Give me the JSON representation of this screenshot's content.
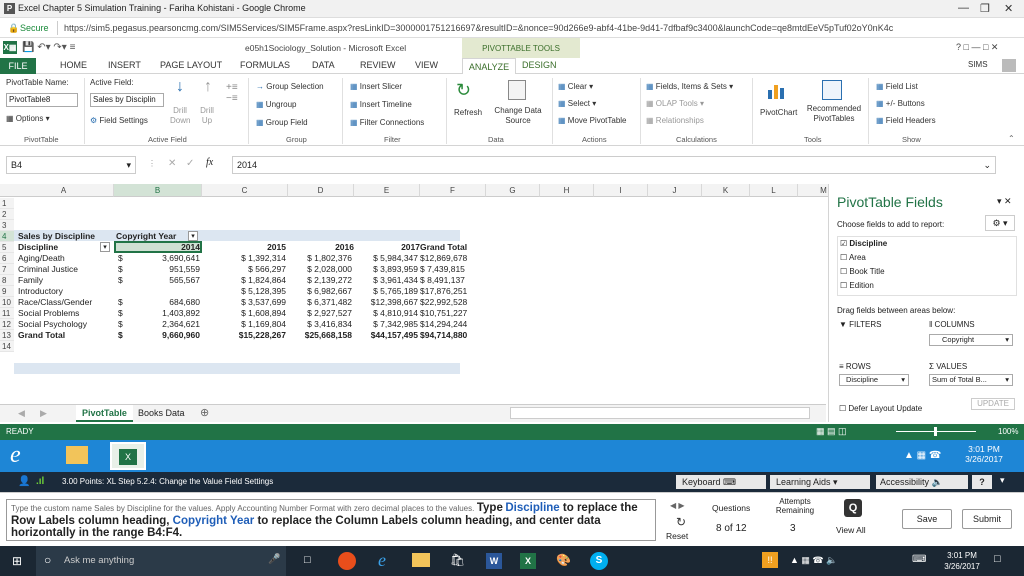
{
  "chrome": {
    "window_title": "Excel Chapter 5 Simulation Training - Fariha Kohistani - Google Chrome",
    "secure_label": "Secure",
    "url": "https://sim5.pegasus.pearsoncmg.com/SIM5Services/SIM5Frame.aspx?resLinkID=3000001751216697&resultID=&nonce=90d266e9-abf4-41be-9d41-7dfbaf9c3400&launchCode=qe8mtdEeV5pTuf02oY0nK4c"
  },
  "excel": {
    "doc_title": "e05h1Sociology_Solution - Microsoft Excel",
    "context_tools": "PIVOTTABLE TOOLS",
    "user": "SIMS",
    "tabs": [
      "FILE",
      "HOME",
      "INSERT",
      "PAGE LAYOUT",
      "FORMULAS",
      "DATA",
      "REVIEW",
      "VIEW",
      "ANALYZE",
      "DESIGN"
    ]
  },
  "ribbon": {
    "pt_name_label": "PivotTable Name:",
    "pt_name_value": "PivotTable8",
    "options": "Options",
    "active_field_label": "Active Field:",
    "active_field_value": "Sales by Disciplin",
    "field_settings": "Field Settings",
    "drill_down": "Drill Down",
    "drill_up": "Drill Up",
    "group_selection": "Group Selection",
    "ungroup": "Ungroup",
    "group_field": "Group Field",
    "insert_slicer": "Insert Slicer",
    "insert_timeline": "Insert Timeline",
    "filter_connections": "Filter Connections",
    "refresh": "Refresh",
    "change_data_source": "Change Data Source",
    "clear": "Clear",
    "select": "Select",
    "move_pivottable": "Move PivotTable",
    "fields_items_sets": "Fields, Items & Sets",
    "olap_tools": "OLAP Tools",
    "relationships": "Relationships",
    "pivotchart": "PivotChart",
    "recommended_pivottables": "Recommended PivotTables",
    "field_list": "Field List",
    "buttons": "+/- Buttons",
    "field_headers": "Field Headers",
    "groups": [
      "PivotTable",
      "Active Field",
      "Group",
      "Filter",
      "Data",
      "Actions",
      "Calculations",
      "Tools",
      "Show"
    ]
  },
  "formula": {
    "namebox": "B4",
    "value": "2014"
  },
  "grid": {
    "columns": [
      "A",
      "B",
      "C",
      "D",
      "E",
      "F",
      "G",
      "H",
      "I",
      "J",
      "K",
      "L",
      "M"
    ],
    "rows": [
      "1",
      "2",
      "3",
      "4",
      "5",
      "6",
      "7",
      "8",
      "9",
      "10",
      "11",
      "12",
      "13",
      "14"
    ],
    "a3": "Sales by Discipline",
    "b3": "Copyright Year",
    "header": [
      "Discipline",
      "2014",
      "2015",
      "2016",
      "2017",
      "Grand Total"
    ],
    "data": [
      [
        "Aging/Death",
        "$",
        "3,690,641",
        "$ 1,392,314",
        "$ 1,802,376",
        "$ 5,984,347",
        "$12,869,678"
      ],
      [
        "Criminal Justice",
        "$",
        "951,559",
        "$ 566,297",
        "$ 2,028,000",
        "$ 3,893,959",
        "$ 7,439,815"
      ],
      [
        "Family",
        "$",
        "565,567",
        "$ 1,824,864",
        "$ 2,139,272",
        "$ 3,961,434",
        "$ 8,491,137"
      ],
      [
        "Introductory",
        "",
        "",
        "$ 5,128,395",
        "$ 6,982,667",
        "$ 5,765,189",
        "$17,876,251"
      ],
      [
        "Race/Class/Gender",
        "$",
        "684,680",
        "$ 3,537,699",
        "$ 6,371,482",
        "$12,398,667",
        "$22,992,528"
      ],
      [
        "Social Problems",
        "$",
        "1,403,892",
        "$ 1,608,894",
        "$ 2,927,527",
        "$ 4,810,914",
        "$10,751,227"
      ],
      [
        "Social Psychology",
        "$",
        "2,364,621",
        "$ 1,169,804",
        "$ 3,416,834",
        "$ 7,342,985",
        "$14,294,244"
      ],
      [
        "Grand Total",
        "$",
        "9,660,960",
        "$15,228,267",
        "$25,668,158",
        "$44,157,495",
        "$94,714,880"
      ]
    ]
  },
  "sheets": [
    "PivotTable",
    "Books Data"
  ],
  "status": {
    "ready": "READY",
    "zoom": "100%"
  },
  "pane": {
    "title": "PivotTable Fields",
    "choose": "Choose fields to add to report:",
    "fields": [
      {
        "name": "Discipline",
        "checked": true
      },
      {
        "name": "Area",
        "checked": false
      },
      {
        "name": "Book Title",
        "checked": false
      },
      {
        "name": "Edition",
        "checked": false
      }
    ],
    "drag": "Drag fields between areas below:",
    "filters": "FILTERS",
    "columns": "COLUMNS",
    "rows": "ROWS",
    "values": "VALUES",
    "col_item": "Copyright",
    "row_item": "Discipline",
    "val_item": "Sum of Total B...",
    "defer": "Defer Layout Update",
    "update": "UPDATE"
  },
  "sim": {
    "clock_time": "3:01 PM",
    "clock_date": "3/26/2017",
    "points": "3.00 Points: XL Step 5.2.4: Change the Value Field Settings",
    "keyboard": "Keyboard",
    "learning_aids": "Learning Aids",
    "accessibility": "Accessibility",
    "help": "?",
    "instruction_small": "Type the custom name Sales by Discipline for the values. Apply Accounting Number Format with zero decimal places to the values.",
    "instruction_type": "Type",
    "instruction_big1": "Discipline",
    "instruction_big2": " to replace the Row Labels column heading, ",
    "instruction_big3": "Copyright Year",
    "instruction_big4": " to replace the Column Labels column heading, and center data horizontally in the range B4:F4.",
    "reset": "Reset",
    "questions_label": "Questions",
    "questions_value": "8 of 12",
    "attempts_label": "Attempts Remaining",
    "attempts_value": "3",
    "view_all": "View All",
    "save": "Save",
    "submit": "Submit"
  },
  "taskbar": {
    "search": "Ask me anything",
    "time": "3:01 PM",
    "date": "3/26/2017"
  }
}
